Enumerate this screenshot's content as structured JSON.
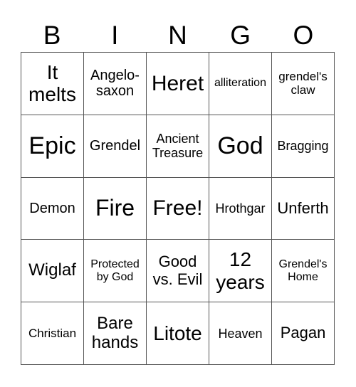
{
  "header": {
    "letters": [
      "B",
      "I",
      "N",
      "G",
      "O"
    ]
  },
  "board": {
    "rows": [
      [
        "It melts",
        "Angelo-saxon",
        "Heret",
        "alliteration",
        "grendel's claw"
      ],
      [
        "Epic",
        "Grendel",
        "Ancient Treasure",
        "God",
        "Bragging"
      ],
      [
        "Demon",
        "Fire",
        "Free!",
        "Hrothgar",
        "Unferth"
      ],
      [
        "Wiglaf",
        "Protected by God",
        "Good vs. Evil",
        "12 years",
        "Grendel's Home"
      ],
      [
        "Christian",
        "Bare hands",
        "Litote",
        "Heaven",
        "Pagan"
      ]
    ],
    "free_space": "Free!"
  }
}
